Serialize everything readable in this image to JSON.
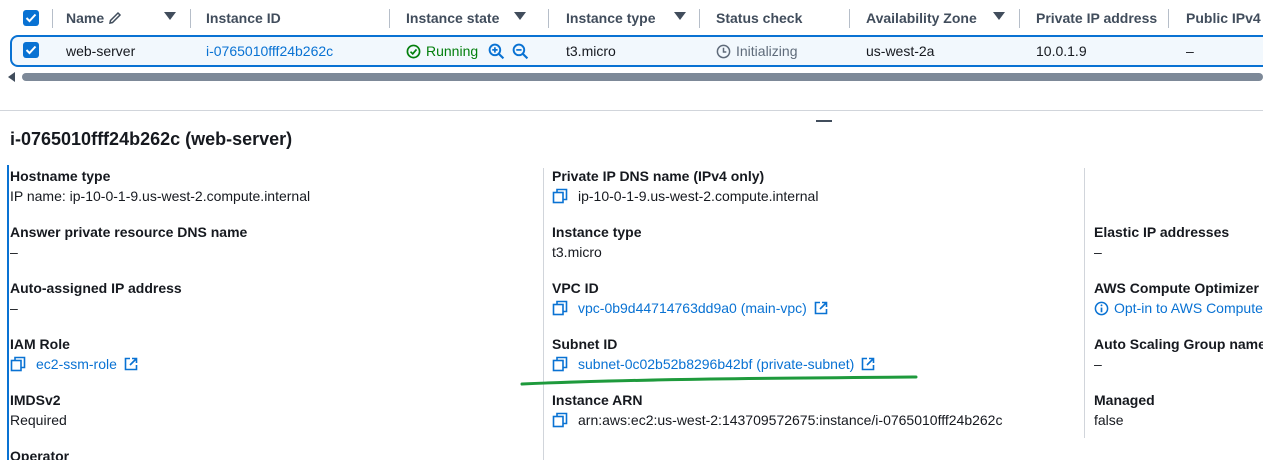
{
  "table": {
    "columns": [
      {
        "label": "Name"
      },
      {
        "label": "Instance ID"
      },
      {
        "label": "Instance state"
      },
      {
        "label": "Instance type"
      },
      {
        "label": "Status check"
      },
      {
        "label": "Availability Zone"
      },
      {
        "label": "Private IP address"
      },
      {
        "label": "Public IPv4"
      }
    ],
    "row": {
      "name": "web-server",
      "instance_id": "i-0765010fff24b262c",
      "state": "Running",
      "type": "t3.micro",
      "status": "Initializing",
      "az": "us-west-2a",
      "private_ip": "10.0.1.9",
      "public_ip": "–"
    }
  },
  "details": {
    "title": "i-0765010fff24b262c (web-server)",
    "col1": [
      {
        "label": "Hostname type",
        "value": "IP name: ip-10-0-1-9.us-west-2.compute.internal"
      },
      {
        "label": "Answer private resource DNS name",
        "value": "–"
      },
      {
        "label": "Auto-assigned IP address",
        "value": "–"
      },
      {
        "label": "IAM Role",
        "value": "ec2-ssm-role"
      },
      {
        "label": "IMDSv2",
        "value": "Required"
      },
      {
        "label": "Operator",
        "value": ""
      }
    ],
    "col2": [
      {
        "label": "Private IP DNS name (IPv4 only)",
        "value": "ip-10-0-1-9.us-west-2.compute.internal"
      },
      {
        "label": "Instance type",
        "value": "t3.micro"
      },
      {
        "label": "VPC ID",
        "value": "vpc-0b9d44714763dd9a0 (main-vpc)"
      },
      {
        "label": "Subnet ID",
        "value": "subnet-0c02b52b8296b42bf (private-subnet)"
      },
      {
        "label": "Instance ARN",
        "value": "arn:aws:ec2:us-west-2:143709572675:instance/i-0765010fff24b262c"
      }
    ],
    "col3": [
      {
        "label": "Elastic IP addresses",
        "value": "–"
      },
      {
        "label": "AWS Compute Optimizer",
        "value": "Opt-in to AWS Compute"
      },
      {
        "label": "Auto Scaling Group name",
        "value": "–"
      },
      {
        "label": "Managed",
        "value": "false"
      }
    ]
  },
  "colors": {
    "link": "#0972d3",
    "running": "#037f0c",
    "annotation": "#1e9a3c"
  }
}
